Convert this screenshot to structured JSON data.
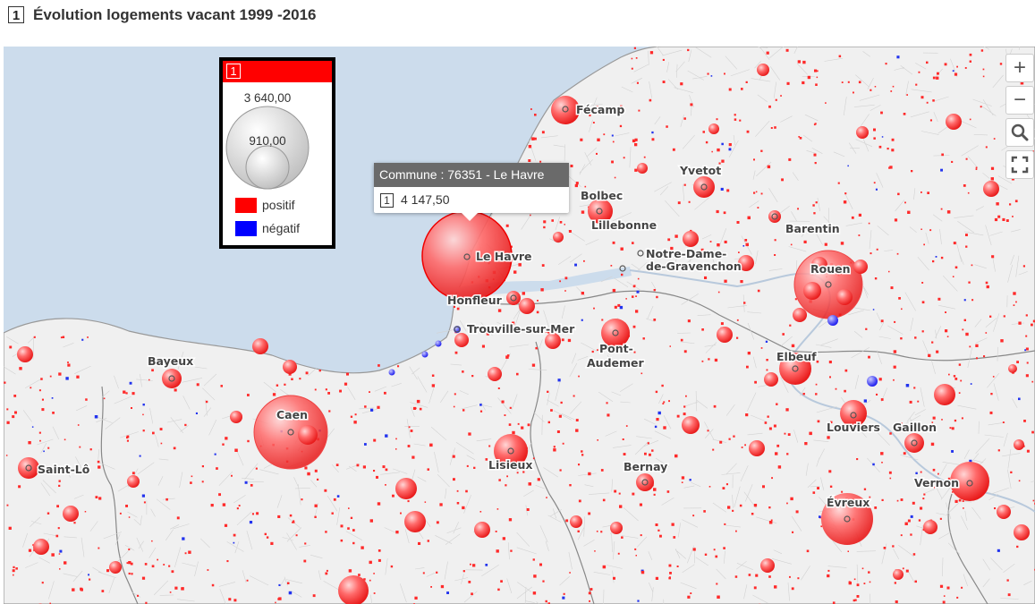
{
  "header": {
    "title_number": "1",
    "title": "Évolution logements vacant 1999 -2016"
  },
  "legend": {
    "number": "1",
    "size_max": "3 640,00",
    "size_min": "910,00",
    "categories": [
      {
        "label": "positif",
        "color": "#ff0000"
      },
      {
        "label": "négatif",
        "color": "#0000ff"
      }
    ]
  },
  "tooltip": {
    "title": "Commune : 76351 - Le Havre",
    "number": "1",
    "value": "4 147,50"
  },
  "controls": {
    "zoom_in": "+",
    "zoom_out": "−",
    "search_icon": "magnifier-icon",
    "fullscreen_icon": "fullscreen-icon"
  },
  "colors": {
    "sea": "#ccdcec",
    "land": "#f0f0f0",
    "positive": "#ff0000",
    "negative": "#0000ff"
  },
  "places": {
    "fecamp": "Fécamp",
    "yvetot": "Yvetot",
    "bolbec": "Bolbec",
    "lillebonne": "Lillebonne",
    "barentin": "Barentin",
    "le_havre": "Le Havre",
    "notre_dame_1": "Notre-Dame-",
    "notre_dame_2": "de-Gravenchon",
    "rouen": "Rouen",
    "honfleur": "Honfleur",
    "trouville": "Trouville-sur-Mer",
    "bayeux": "Bayeux",
    "pont_1": "Pont-",
    "pont_2": "Audemer",
    "elbeuf": "Elbeuf",
    "caen": "Caen",
    "louviers": "Louviers",
    "gaillon": "Gaillon",
    "saint_lo": "Saint-Lô",
    "lisieux": "Lisieux",
    "bernay": "Bernay",
    "vernon": "Vernon",
    "evreux": "Évreux"
  }
}
